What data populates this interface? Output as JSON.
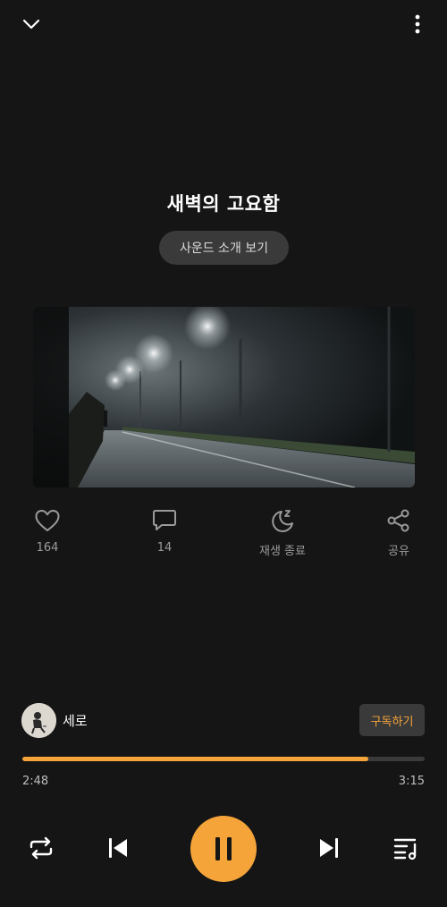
{
  "track": {
    "title": "새벽의 고요함",
    "intro_label": "사운드 소개 보기"
  },
  "actions": {
    "like_count": "164",
    "comment_count": "14",
    "sleep_label": "재생 종료",
    "share_label": "공유"
  },
  "artist": {
    "name": "세로",
    "subscribe_label": "구독하기"
  },
  "playback": {
    "current_time": "2:48",
    "total_time": "3:15",
    "progress_fraction": 0.86,
    "state": "playing"
  },
  "icons": {
    "collapse": "chevron-down-icon",
    "more": "more-vertical-icon",
    "like": "heart-icon",
    "comment": "comment-icon",
    "sleep": "moon-sleep-icon",
    "share": "share-icon",
    "repeat": "repeat-icon",
    "prev": "skip-previous-icon",
    "pause": "pause-icon",
    "next": "skip-next-icon",
    "playlist": "playlist-icon"
  },
  "colors": {
    "accent": "#f5a43a",
    "background": "#151515"
  }
}
